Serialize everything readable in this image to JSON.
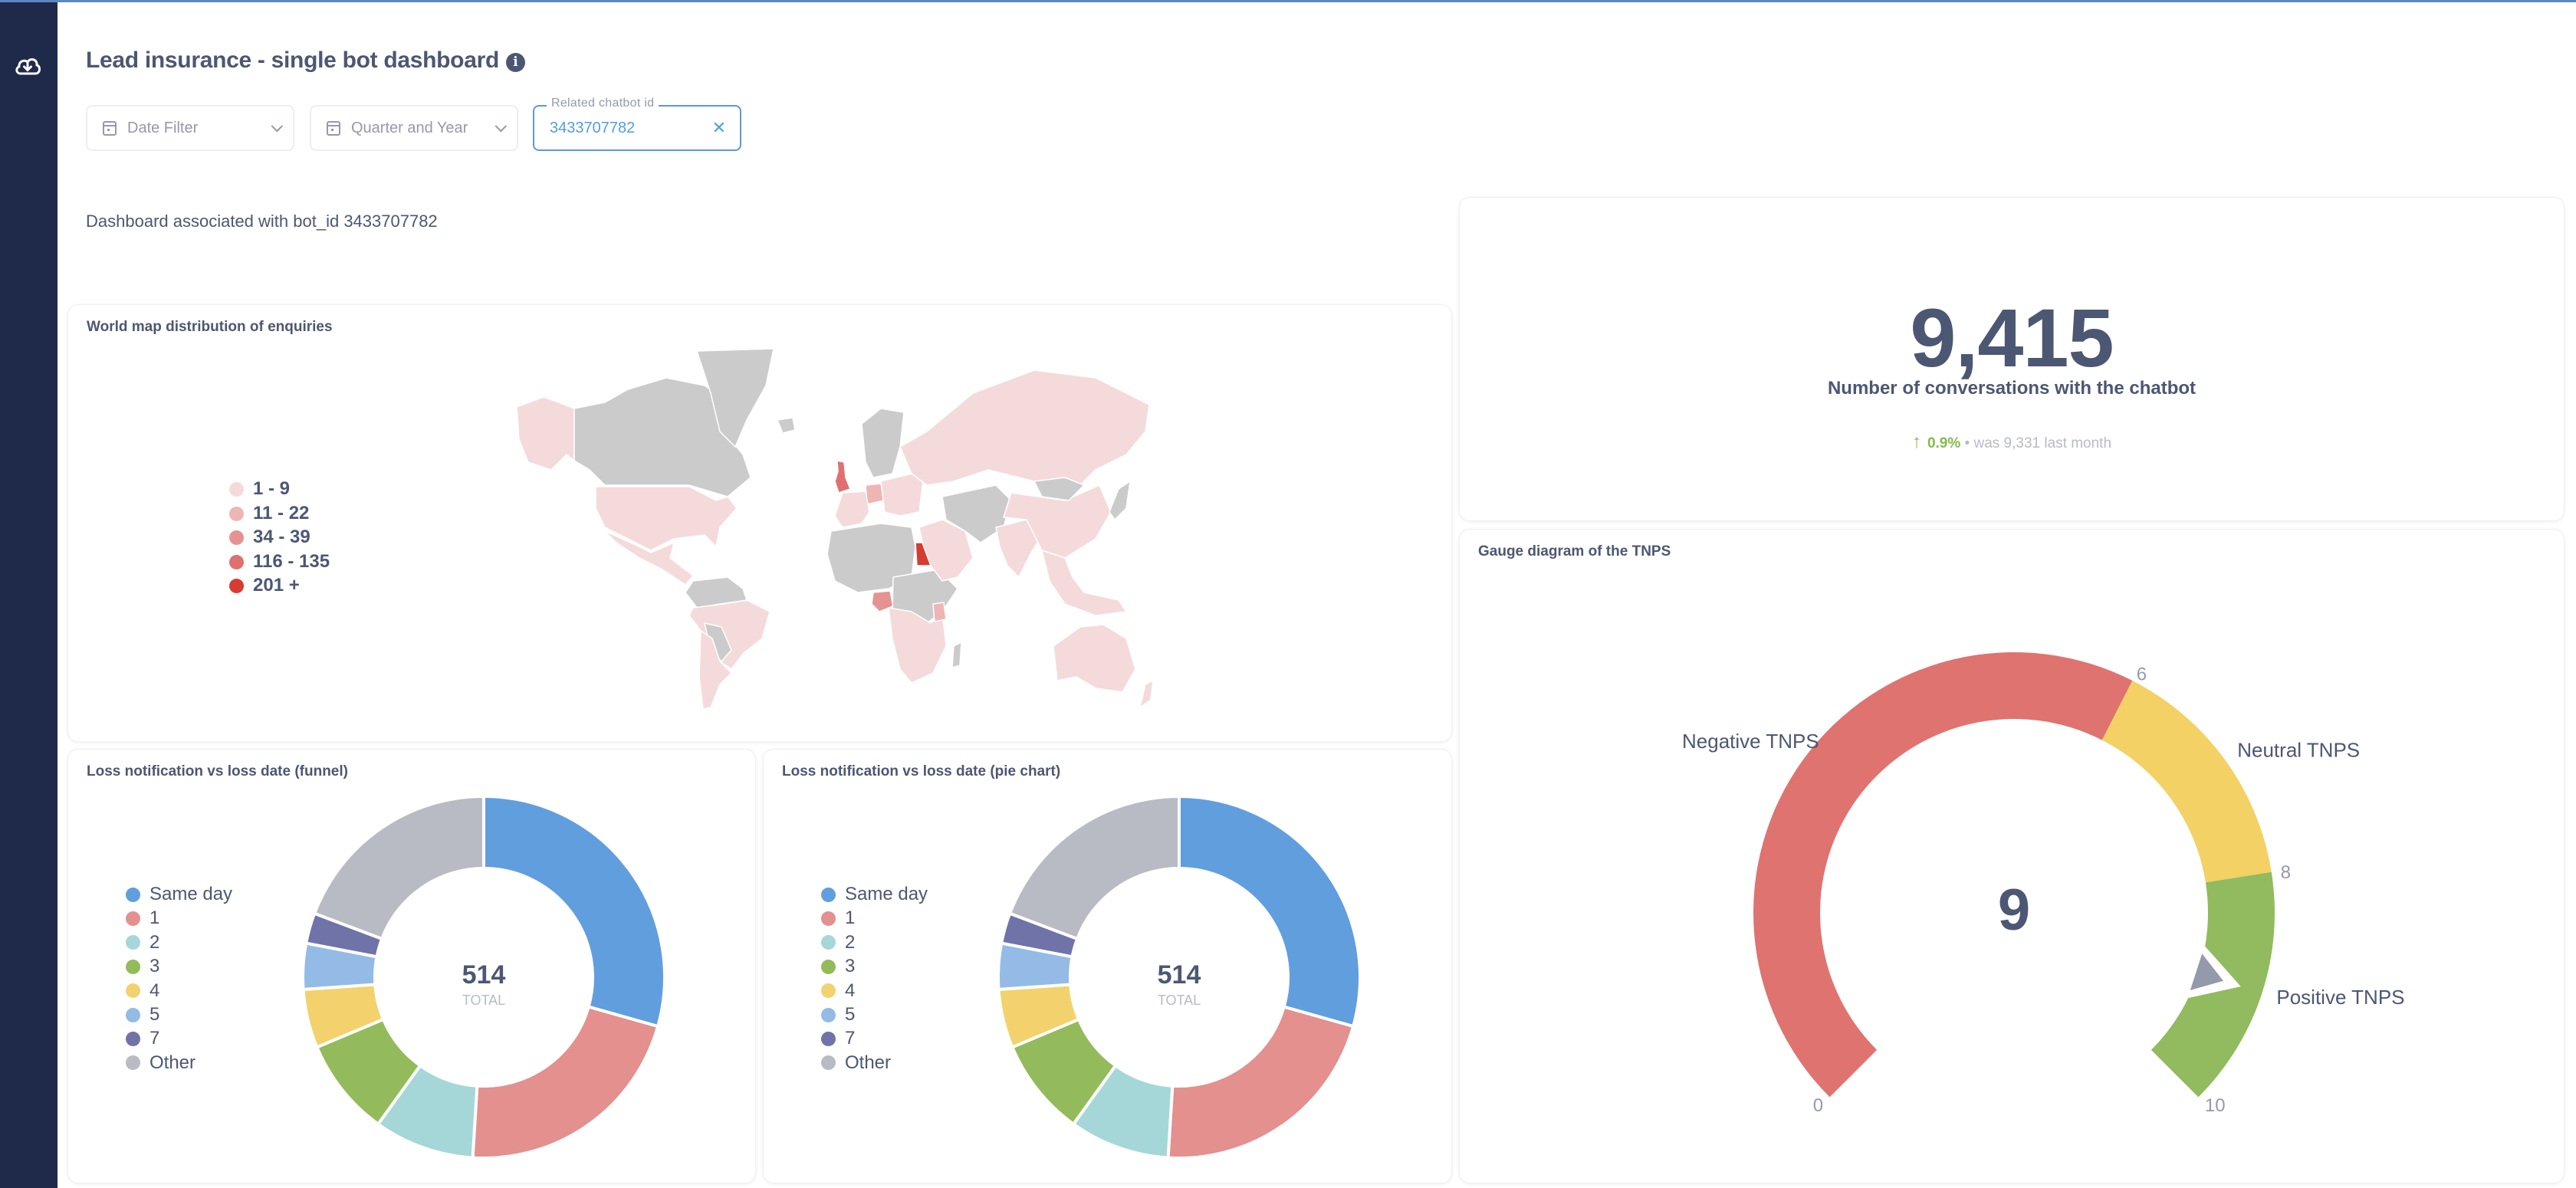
{
  "header": {
    "title": "Lead insurance - single bot dashboard",
    "info_icon": "info-icon"
  },
  "sidebar": {
    "icon": "cloud-download-icon"
  },
  "filters": {
    "date_filter": {
      "label": "Date Filter",
      "icon": "calendar-icon"
    },
    "quarter_year": {
      "label": "Quarter and Year",
      "icon": "calendar-icon"
    },
    "chatbot_id": {
      "label": "Related chatbot id",
      "value": "3433707782",
      "clear_icon": "close-icon"
    }
  },
  "text_card": "Dashboard associated with bot_id 3433707782",
  "kpi": {
    "value": "9,415",
    "label": "Number of conversations with the chatbot",
    "change": "0.9%",
    "change_direction": "up",
    "comparison": "• was 9,331  last month",
    "color_up": "#84bb4c"
  },
  "colors": {
    "text_dark": "#4c5773",
    "text_light": "#949aab",
    "accent": "#509ee3",
    "sidebar": "#1f2a4a",
    "no_data": "#cbcbcb"
  },
  "chart_data": [
    {
      "type": "map",
      "title": "World map distribution of enquiries",
      "legend_placement": "left",
      "legend": [
        {
          "label": "1 - 9",
          "color": "#f5dadb"
        },
        {
          "label": "11 - 22",
          "color": "#efb5b5"
        },
        {
          "label": "34 - 39",
          "color": "#e69292"
        },
        {
          "label": "116 - 135",
          "color": "#e07070"
        },
        {
          "label": "201 +",
          "color": "#d63c31"
        }
      ],
      "regions": [
        {
          "name": "Alaska (USA)",
          "bucket": 0
        },
        {
          "name": "Canada",
          "bucket": null
        },
        {
          "name": "Greenland",
          "bucket": null
        },
        {
          "name": "Iceland",
          "bucket": null
        },
        {
          "name": "United States",
          "bucket": 0
        },
        {
          "name": "Mexico & Central America",
          "bucket": 0
        },
        {
          "name": "Northern South America",
          "bucket": null
        },
        {
          "name": "Brazil & Peru",
          "bucket": 0
        },
        {
          "name": "Bolivia & Paraguay",
          "bucket": null
        },
        {
          "name": "Argentina & Chile",
          "bucket": 0
        },
        {
          "name": "United Kingdom",
          "bucket": 3
        },
        {
          "name": "Germany",
          "bucket": 1
        },
        {
          "name": "Western Europe",
          "bucket": 0
        },
        {
          "name": "Scandinavia",
          "bucket": null
        },
        {
          "name": "Eastern Europe",
          "bucket": 0
        },
        {
          "name": "Russia",
          "bucket": 0
        },
        {
          "name": "North Africa",
          "bucket": null
        },
        {
          "name": "Egypt",
          "bucket": 4
        },
        {
          "name": "Nigeria",
          "bucket": 2
        },
        {
          "name": "Central Africa",
          "bucket": null
        },
        {
          "name": "Southern Africa",
          "bucket": 0
        },
        {
          "name": "Kenya",
          "bucket": 1
        },
        {
          "name": "Madagascar",
          "bucket": null
        },
        {
          "name": "Middle East",
          "bucket": 0
        },
        {
          "name": "Iran & Central Asia",
          "bucket": null
        },
        {
          "name": "India",
          "bucket": 0
        },
        {
          "name": "China",
          "bucket": 0
        },
        {
          "name": "Mongolia",
          "bucket": null
        },
        {
          "name": "Southeast Asia",
          "bucket": 0
        },
        {
          "name": "Japan",
          "bucket": null
        },
        {
          "name": "Australia",
          "bucket": 0
        },
        {
          "name": "New Zealand",
          "bucket": 0
        }
      ]
    },
    {
      "type": "pie",
      "title": "Loss notification vs loss date (funnel)",
      "total": 514,
      "total_label": "TOTAL",
      "legend_placement": "left",
      "categories": [
        "Same day",
        "1",
        "2",
        "3",
        "4",
        "5",
        "7",
        "Other"
      ],
      "values": [
        151,
        111,
        46,
        45,
        27,
        21,
        14,
        99
      ],
      "colors": [
        "#619ede",
        "#e3908e",
        "#a5d7d8",
        "#93bb5c",
        "#f3d26e",
        "#93bbe6",
        "#6f73a8",
        "#b8bbc3"
      ]
    },
    {
      "type": "pie",
      "title": "Loss notification vs loss date (pie chart)",
      "total": 514,
      "total_label": "TOTAL",
      "legend_placement": "left",
      "categories": [
        "Same day",
        "1",
        "2",
        "3",
        "4",
        "5",
        "7",
        "Other"
      ],
      "values": [
        151,
        111,
        46,
        45,
        27,
        21,
        14,
        99
      ],
      "colors": [
        "#619ede",
        "#e3908e",
        "#a5d7d8",
        "#93bb5c",
        "#f3d26e",
        "#93bbe6",
        "#6f73a8",
        "#b8bbc3"
      ]
    },
    {
      "type": "gauge",
      "title": "Gauge diagram of the TNPS",
      "value": 9,
      "min": 0,
      "max": 10,
      "segments": [
        {
          "label": "Negative TNPS",
          "from": 0,
          "to": 6,
          "color": "#df7370"
        },
        {
          "label": "Neutral TNPS",
          "from": 6,
          "to": 8,
          "color": "#f3d165"
        },
        {
          "label": "Positive TNPS",
          "from": 8,
          "to": 10,
          "color": "#91bb5e"
        }
      ],
      "tick_labels": [
        "0",
        "6",
        "8",
        "10"
      ],
      "needle_color": "#949aab"
    }
  ]
}
